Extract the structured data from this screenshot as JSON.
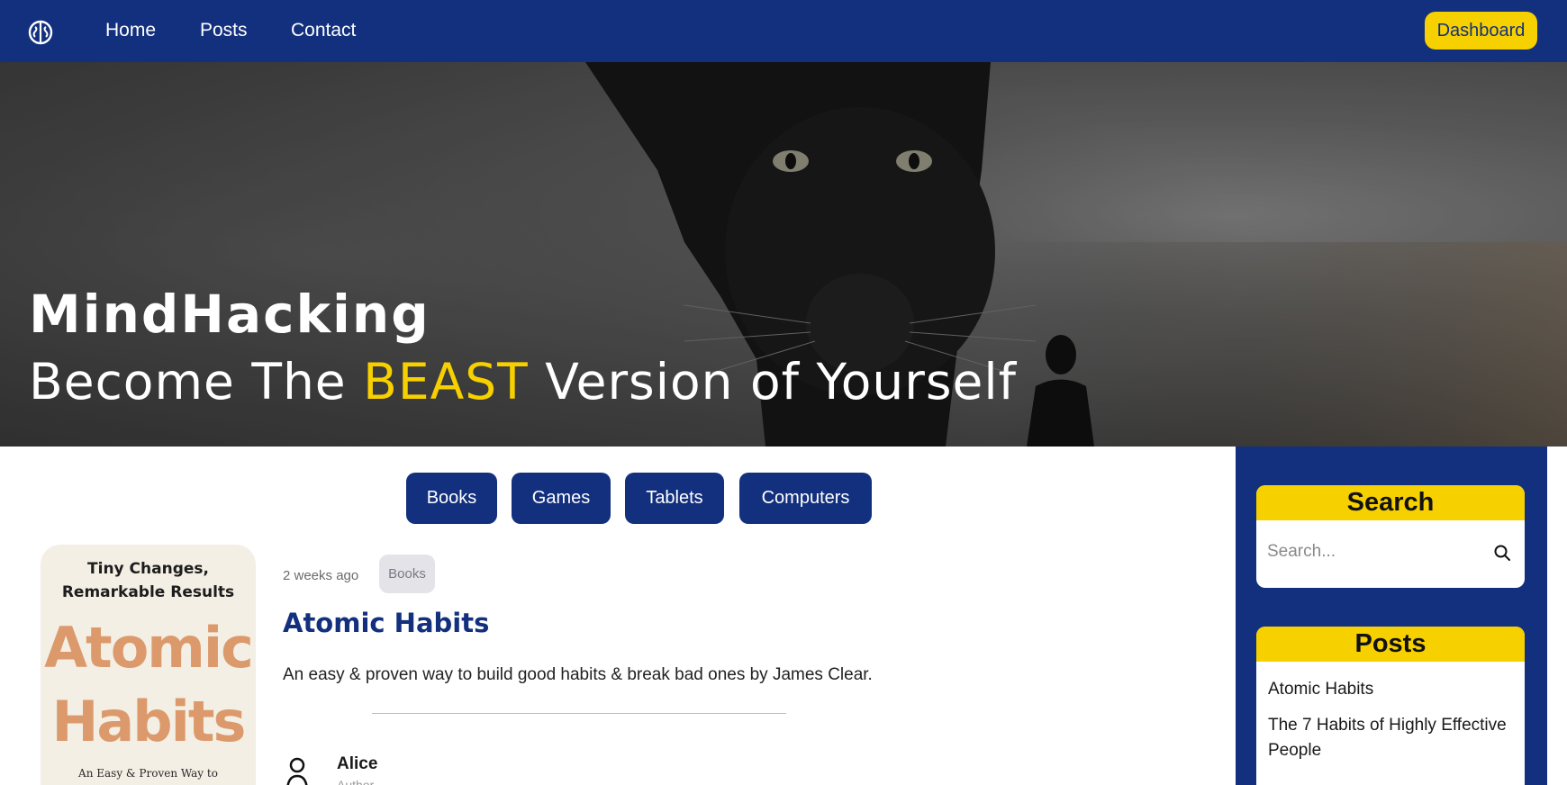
{
  "nav": {
    "logo_icon": "brain-icon",
    "links": [
      "Home",
      "Posts",
      "Contact"
    ],
    "dashboard_label": "Dashboard"
  },
  "hero": {
    "title": "MindHacking",
    "subtitle_before": "Become The ",
    "subtitle_accent": "BEAST",
    "subtitle_after": " Version of Yourself"
  },
  "categories": [
    "Books",
    "Games",
    "Tablets",
    "Computers"
  ],
  "post": {
    "cover": {
      "tagline_line1": "Tiny Changes,",
      "tagline_line2": "Remarkable Results",
      "title_line1": "Atomic",
      "title_line2": "Habits",
      "bottom_text": "An Easy & Proven Way to"
    },
    "time": "2 weeks ago",
    "tag": "Books",
    "title": "Atomic Habits",
    "excerpt": "An easy & proven way to build good habits & break bad ones by James Clear.",
    "author_icon": "user-icon",
    "author_name": "Alice",
    "author_role": "Author"
  },
  "sidebar": {
    "search": {
      "heading": "Search",
      "placeholder": "Search...",
      "icon": "search-icon"
    },
    "posts": {
      "heading": "Posts",
      "items": [
        "Atomic Habits",
        "The 7 Habits of Highly Effective People"
      ]
    }
  },
  "colors": {
    "primary": "#13307e",
    "accent": "#f7d000",
    "tag_bg": "#e4e4e8"
  }
}
